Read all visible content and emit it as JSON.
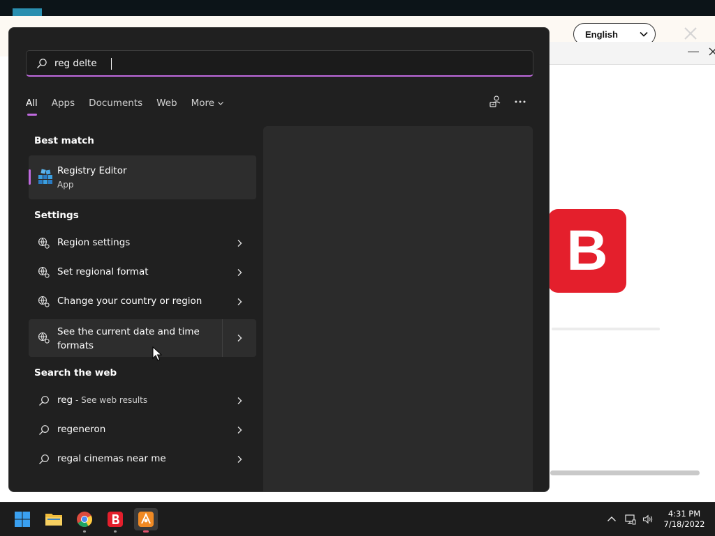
{
  "background": {
    "language_select": "English",
    "brand_logo_letter": "B"
  },
  "search": {
    "query": "reg delte"
  },
  "tabs": [
    {
      "label": "All",
      "active": true
    },
    {
      "label": "Apps"
    },
    {
      "label": "Documents"
    },
    {
      "label": "Web"
    },
    {
      "label": "More"
    }
  ],
  "best_match": {
    "heading": "Best match",
    "title": "Registry Editor",
    "subtitle": "App"
  },
  "settings": {
    "heading": "Settings",
    "items": [
      "Region settings",
      "Set regional format",
      "Change your country or region",
      "See the current date and time formats"
    ]
  },
  "web": {
    "heading": "Search the web",
    "items": [
      {
        "query": "reg",
        "suffix": " - See web results"
      },
      {
        "query": "regeneron"
      },
      {
        "query": "regal cinemas near me"
      }
    ]
  },
  "taskbar": {
    "time": "4:31 PM",
    "date": "7/18/2022",
    "apps": [
      "windows-start",
      "file-explorer",
      "chrome",
      "bitdefender",
      "installer"
    ]
  },
  "colors": {
    "accent": "#c06adf",
    "panel_bg": "#202020",
    "brand_red": "#e41f2c"
  }
}
